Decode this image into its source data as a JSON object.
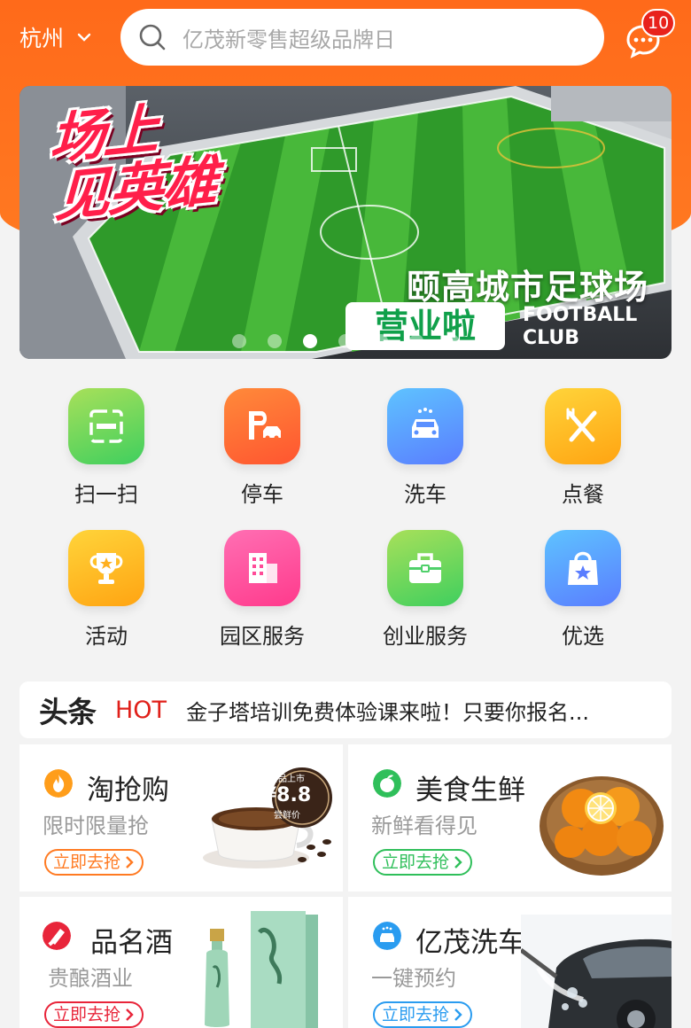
{
  "header": {
    "city": "杭州",
    "search_placeholder": "亿茂新零售超级品牌日",
    "message_count": "10"
  },
  "banner": {
    "title_line1": "场上",
    "title_line2": "见英雄",
    "subtitle": "颐高城市足球场",
    "open_label": "营业啦",
    "en_line1": "FOOTBALL",
    "en_line2": "CLUB",
    "slides": 7,
    "active_slide": 3
  },
  "services": [
    {
      "label": "扫一扫",
      "icon": "scan-icon",
      "color_from": "#a8e05a",
      "color_to": "#3fcf5e"
    },
    {
      "label": "停车",
      "icon": "parking-icon",
      "color_from": "#ff8a3a",
      "color_to": "#ff5530"
    },
    {
      "label": "洗车",
      "icon": "car-wash-icon",
      "color_from": "#5ec3ff",
      "color_to": "#5a7dff"
    },
    {
      "label": "点餐",
      "icon": "fork-knife-icon",
      "color_from": "#ffd43a",
      "color_to": "#ffa412"
    },
    {
      "label": "活动",
      "icon": "trophy-icon",
      "color_from": "#ffd43a",
      "color_to": "#ffa412"
    },
    {
      "label": "园区服务",
      "icon": "building-icon",
      "color_from": "#ff6fb3",
      "color_to": "#ff3a8c"
    },
    {
      "label": "创业服务",
      "icon": "briefcase-icon",
      "color_from": "#a8e05a",
      "color_to": "#3fcf5e"
    },
    {
      "label": "优选",
      "icon": "shopping-bag-icon",
      "color_from": "#5ec3ff",
      "color_to": "#5a7dff"
    }
  ],
  "news": {
    "title": "头条",
    "hot": "HOT",
    "text": "金子塔培训免费体验课来啦！只要你报名..."
  },
  "cards": [
    {
      "name": "淘抢购",
      "desc": "限时限量抢",
      "button": "立即去抢",
      "color": "#ff7a22",
      "icon": "flame-icon",
      "price_tag_top": "新品上市",
      "price_tag_price": "¥8.8",
      "price_tag_bottom": "尝鲜价"
    },
    {
      "name": "美食生鲜",
      "desc": "新鲜看得见",
      "button": "立即去抢",
      "color": "#2fbf5a",
      "icon": "orange-fruit-icon"
    },
    {
      "name": "品名酒",
      "desc": "贵酿酒业",
      "button": "立即去抢",
      "color": "#e8253a",
      "icon": "wine-icon"
    },
    {
      "name": "亿茂洗车",
      "desc": "一键预约",
      "button": "立即去抢",
      "color": "#2a9cf0",
      "icon": "car-wash-icon"
    }
  ],
  "colors": {
    "brand": "#ff6a1a",
    "hot": "#e0201a",
    "background": "#f3f3f3"
  }
}
